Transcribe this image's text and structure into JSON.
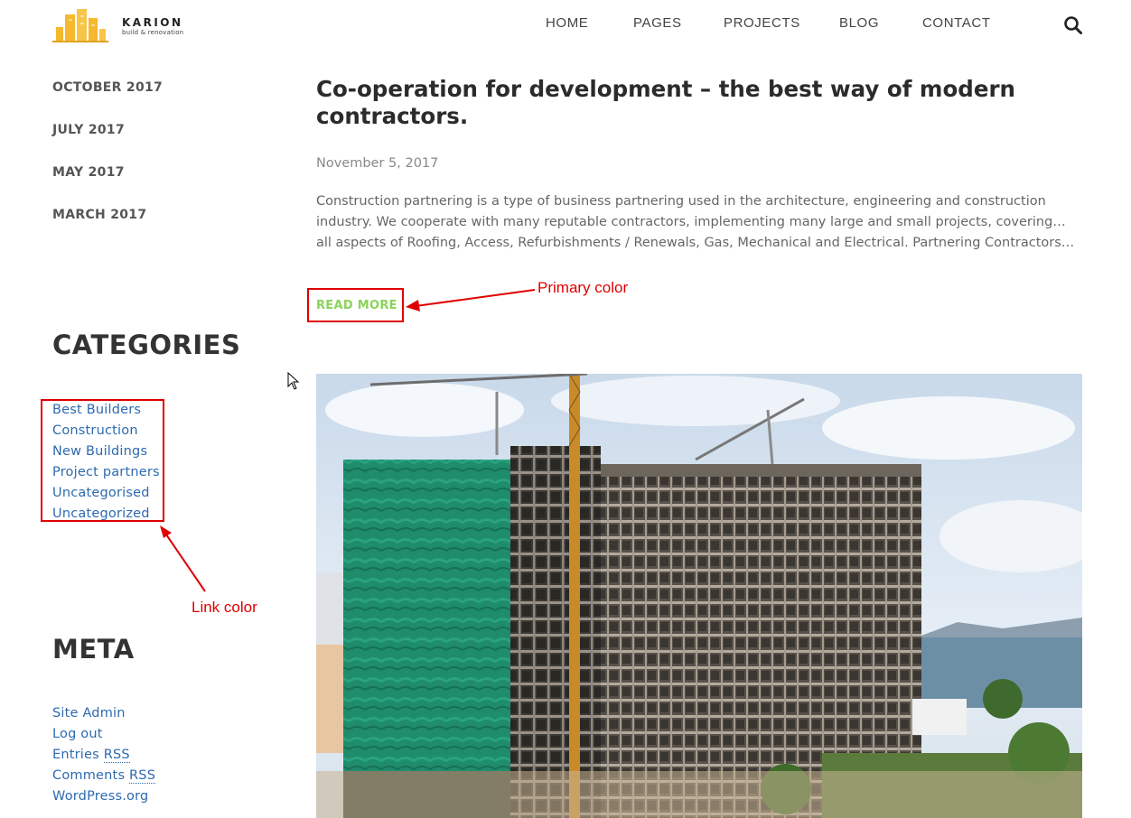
{
  "header": {
    "logo": {
      "name": "KARION",
      "tagline": "build & renovation"
    },
    "nav": [
      {
        "label": "HOME"
      },
      {
        "label": "PAGES"
      },
      {
        "label": "PROJECTS"
      },
      {
        "label": "BLOG"
      },
      {
        "label": "CONTACT"
      }
    ],
    "search_icon": "search-icon"
  },
  "sidebar": {
    "archives": [
      {
        "label": "OCTOBER 2017"
      },
      {
        "label": "JULY 2017"
      },
      {
        "label": "MAY 2017"
      },
      {
        "label": "MARCH 2017"
      }
    ],
    "categories": {
      "title": "CATEGORIES",
      "items": [
        {
          "label": "Best Builders"
        },
        {
          "label": "Construction"
        },
        {
          "label": "New Buildings"
        },
        {
          "label": "Project partners"
        },
        {
          "label": "Uncategorised"
        },
        {
          "label": "Uncategorized"
        }
      ]
    },
    "meta": {
      "title": "META",
      "site_admin": "Site Admin",
      "log_out": "Log out",
      "entries": "Entries",
      "comments": "Comments",
      "rss": "RSS",
      "wordpress": "WordPress.org"
    }
  },
  "post": {
    "title": "Co-operation for development – the best way of modern contractors.",
    "date": "November 5, 2017",
    "excerpt": "Construction partnering is a type of business partnering used in the architecture, engineering and construction industry. We cooperate with many reputable contractors, implementing many large and small projects, covering… all aspects of Roofing, Access, Refurbishments / Renewals, Gas, Mechanical and Electrical. Partnering Contractors…",
    "read_more": "READ MORE"
  },
  "annotations": {
    "primary_color": "Primary color",
    "link_color": "Link color"
  },
  "colors": {
    "primary": "#8ad35b",
    "link": "#2d6ab0",
    "annotation": "#e00000",
    "logo": "#f5b82e"
  }
}
